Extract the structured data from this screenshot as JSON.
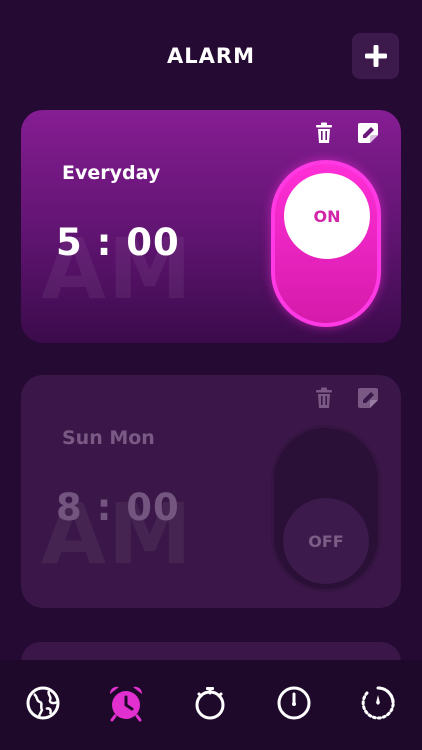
{
  "header": {
    "title": "ALARM",
    "add_icon": "plus-icon"
  },
  "colors": {
    "background": "#250a33",
    "accent": "#ff2fd7",
    "card_active": "#861d93",
    "card_inactive": "#3a1748"
  },
  "alarms": [
    {
      "days": "Everyday",
      "time": "5 : 00",
      "period": "AM",
      "toggle_label": "ON",
      "enabled": true
    },
    {
      "days": "Sun Mon",
      "time": "8 : 00",
      "period": "AM",
      "toggle_label": "OFF",
      "enabled": false
    }
  ],
  "tabbar": {
    "items": [
      {
        "icon": "world-clock-icon",
        "active": false
      },
      {
        "icon": "alarm-icon",
        "active": true
      },
      {
        "icon": "stopwatch-icon",
        "active": false
      },
      {
        "icon": "clock-icon",
        "active": false
      },
      {
        "icon": "timer-icon",
        "active": false
      }
    ]
  }
}
